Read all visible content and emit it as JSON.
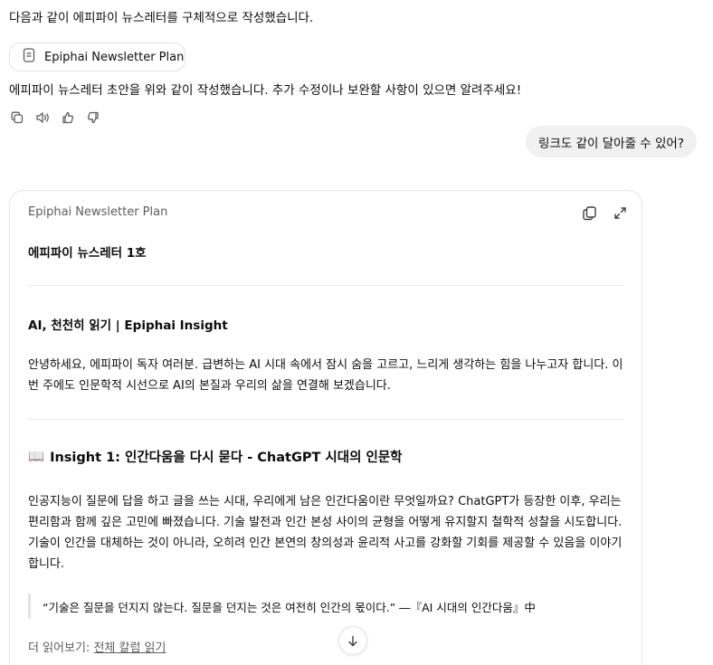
{
  "chat": {
    "intro_text": "다음과 같이 에피파이 뉴스레터를 구체적으로 작성했습니다.",
    "doc_chip_label": "Epiphai Newsletter Plan",
    "reply_text": "에피파이 뉴스레터 초안을 위와 같이 작성했습니다. 추가 수정이나 보완할 사항이 있으면 알려주세요!",
    "user_message": "링크도 같이 달아줄 수 있어?"
  },
  "canvas": {
    "title": "Epiphai Newsletter Plan",
    "heading_main": "에피파이 뉴스레터 1호",
    "heading_sub": "AI, 천천히 읽기 | Epiphai Insight",
    "intro_lines": [
      "안녕하세요, 에피파이 독자 여러분. 급변하는 AI 시대 속에서 잠시 숨을 고르고, 느리게 생각하는 힘을 나누고자 합니다. 이",
      "번 주에도 인문학적 시선으로 AI의 본질과 우리의 삶을 연결해 보겠습니다."
    ],
    "insight_emoji": "📖",
    "insight_heading": "Insight 1: 인간다움을 다시 묻다 - ChatGPT 시대의 인문학",
    "insight_lines": [
      "인공지능이 질문에 답을 하고 글을 쓰는 시대, 우리에게 남은 인간다움이란 무엇일까요? ChatGPT가 등장한 이후, 우리는",
      "편리함과 함께 깊은 고민에 빠졌습니다. 기술 발전과 인간 본성 사이의 균형을 어떻게 유지할지 철학적 성찰을 시도합니다.",
      "기술이 인간을 대체하는 것이 아니라, 오히려 인간 본연의 창의성과 윤리적 사고를 강화할 기회를 제공할 수 있음을 이야기",
      "합니다."
    ],
    "quote_text": "“기술은 질문을 던지지 않는다. 질문을 던지는 것은 여전히 인간의 몫이다.” ―『AI 시대의 인간다움』中",
    "read_more_prefix": "더 읽어보기: ",
    "read_more_link": "전체 칼럼 읽기"
  },
  "icons": {
    "doc": "document-icon",
    "copy": "copy-icon",
    "read_aloud": "speaker-icon",
    "like": "thumbs-up-icon",
    "dislike": "thumbs-down-icon",
    "expand": "expand-icon",
    "scroll": "arrow-down-icon"
  }
}
